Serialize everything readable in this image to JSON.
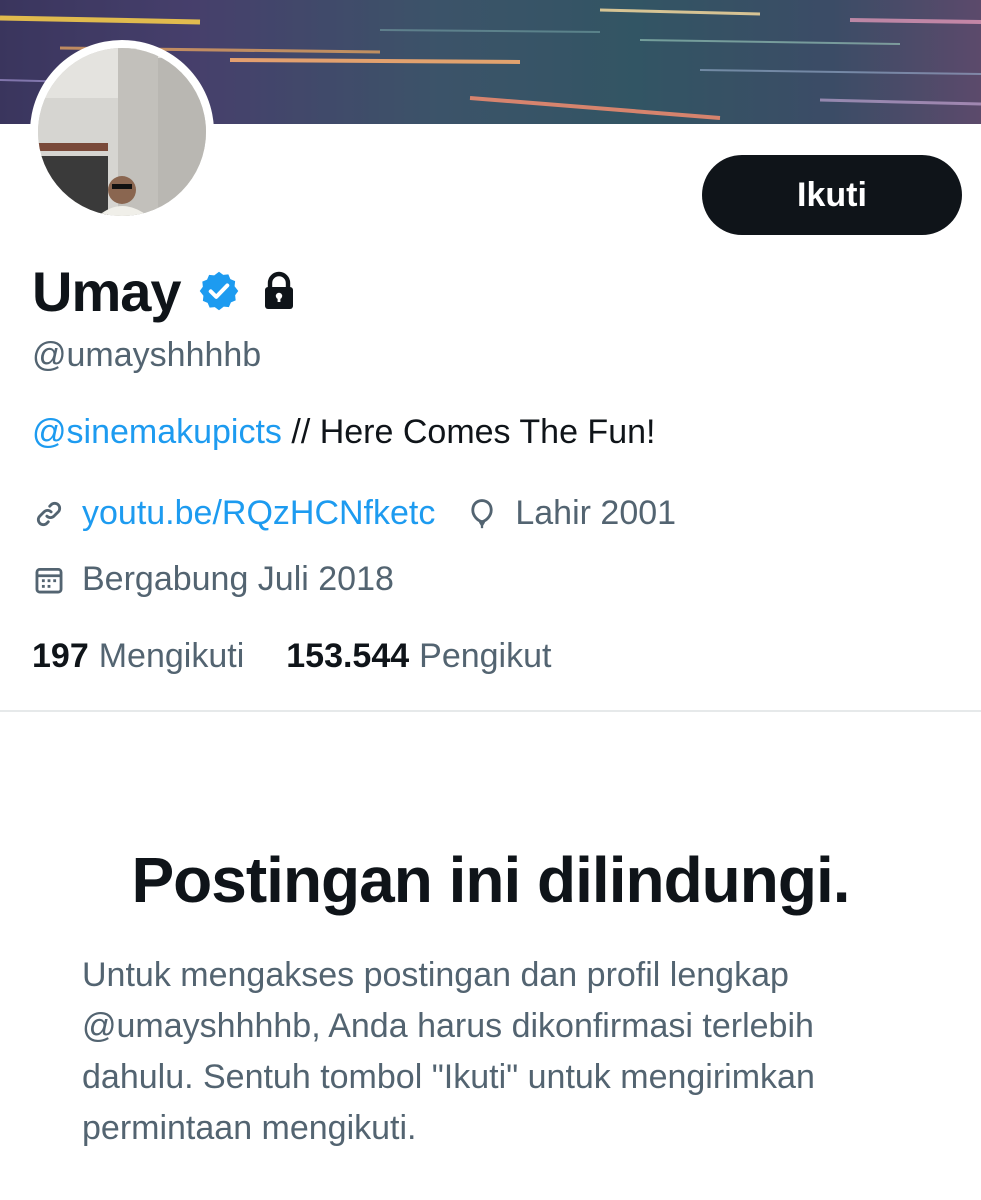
{
  "profile": {
    "display_name": "Umay",
    "handle": "@umayshhhhb",
    "bio_mention": "@sinemakupicts",
    "bio_text": " // Here Comes The Fun!",
    "website": "youtu.be/RQzHCNfketc",
    "birth": "Lahir 2001",
    "joined": "Bergabung Juli 2018",
    "following_count": "197",
    "following_label": "Mengikuti",
    "followers_count": "153.544",
    "followers_label": "Pengikut",
    "verified_icon": "verified-badge-icon",
    "lock_icon": "lock-icon"
  },
  "actions": {
    "follow_label": "Ikuti"
  },
  "protected": {
    "title": "Postingan ini dilindungi.",
    "body": "Untuk mengakses postingan dan profil lengkap @umayshhhhb, Anda harus dikonfirmasi terlebih dahulu. Sentuh tombol \"Ikuti\" untuk mengirimkan permintaan mengikuti."
  },
  "colors": {
    "accent": "#1d9bf0",
    "text_primary": "#0f1419",
    "text_secondary": "#536471",
    "button_bg": "#0f1419"
  }
}
